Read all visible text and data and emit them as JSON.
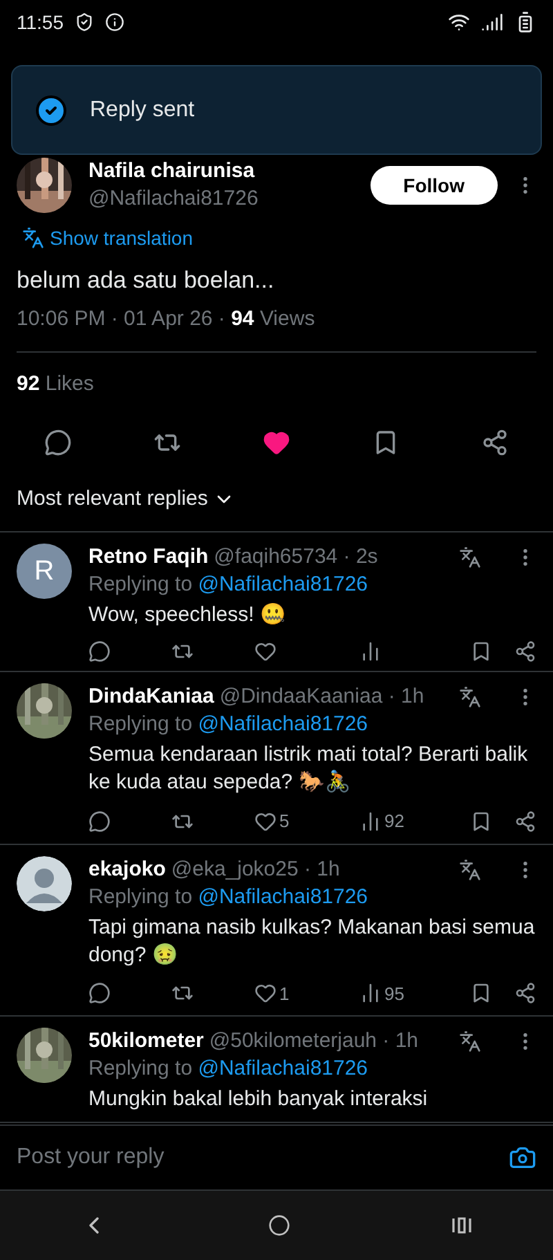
{
  "status_bar": {
    "time": "11:55"
  },
  "toast": {
    "text": "Reply sent"
  },
  "post": {
    "author": "Nafila chairunisa",
    "handle": "@Nafilachai81726",
    "follow_button": "Follow",
    "translate_link": "Show translation",
    "text": "belum ada satu boelan...",
    "meta": "10:06 PM · 01 Apr 26 · ",
    "views_count": "94",
    "views_label": " Views",
    "likes_count": "92",
    "likes_label": "Likes",
    "liked": true,
    "bookmarked": false
  },
  "sort": {
    "label": "Most relevant replies"
  },
  "replies": [
    {
      "name": "Retno Faqih",
      "handle": "@faqih65734 · 2s",
      "avatar": {
        "kind": "letter",
        "letter": "R"
      },
      "replying_label": "Replying to ",
      "replying_to": "@Nafilachai81726",
      "text": "Wow, speechless! 🤐",
      "liked": false
    },
    {
      "name": "DindaKaniaa",
      "handle": "@DindaaKaaniaa · 1h",
      "replying_label": "Replying to ",
      "replying_to": "@Nafilachai81726",
      "text": "Semua kendaraan listrik mati total? Berarti balik ke kuda atau sepeda? 🐎🚴",
      "liked": false,
      "likes": "5",
      "views": "92"
    },
    {
      "name": "ekajoko",
      "handle": "@eka_joko25 · 1h",
      "avatar": {
        "kind": "default"
      },
      "replying_label": "Replying to ",
      "replying_to": "@Nafilachai81726",
      "text": "Tapi gimana nasib kulkas? Makanan basi semua dong? 🤢",
      "liked": false,
      "likes": "1",
      "views": "95"
    },
    {
      "name": "50kilometer",
      "handle": "@50kilometerjauh · 1h",
      "replying_label": "Replying to ",
      "replying_to": "@Nafilachai81726",
      "text": "Mungkin bakal lebih banyak interaksi"
    }
  ],
  "composer": {
    "placeholder": "Post your reply"
  }
}
